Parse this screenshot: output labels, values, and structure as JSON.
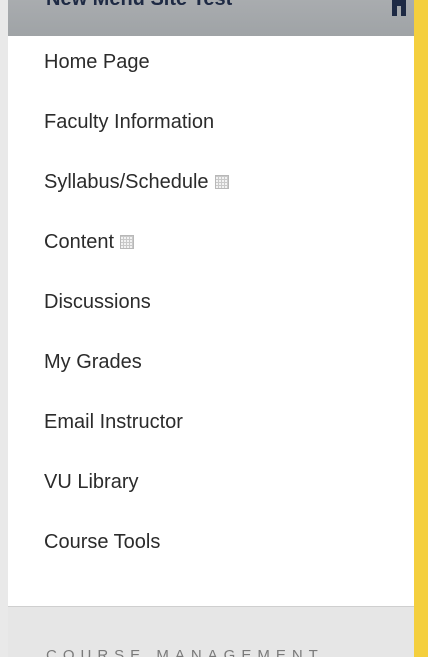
{
  "header": {
    "title": "New Menu Site Test",
    "icon": "home-icon"
  },
  "menu": {
    "items": [
      {
        "label": "Home Page"
      },
      {
        "label": "Faculty Information"
      },
      {
        "label": "Syllabus/Schedule",
        "icon": "context-menu-icon"
      },
      {
        "label": "Content",
        "icon": "context-menu-icon"
      },
      {
        "label": "Discussions"
      },
      {
        "label": "My Grades"
      },
      {
        "label": "Email Instructor"
      },
      {
        "label": "VU Library"
      },
      {
        "label": "Course Tools"
      }
    ]
  },
  "footer": {
    "section_label": "COURSE MANAGEMENT"
  },
  "colors": {
    "accent": "#f4cf3e",
    "header_bg": "#a5a9ac",
    "text": "#2b2b2b"
  }
}
